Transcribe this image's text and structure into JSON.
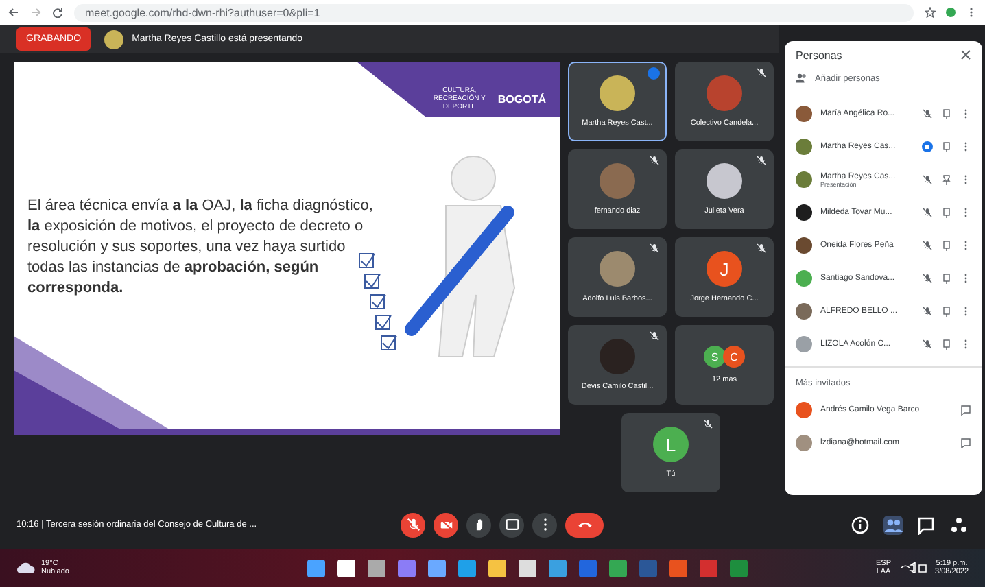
{
  "browser": {
    "url": "meet.google.com/rhd-dwn-rhi?authuser=0&pli=1"
  },
  "meet_header": {
    "recording_label": "GRABANDO",
    "presenter_text": "Martha Reyes Castillo está presentando"
  },
  "slide": {
    "body": "El área técnica envía **a la** OAJ, **la** ficha diagnóstico, **la** exposición de motivos, el proyecto de decreto o resolución y sus soportes, una vez haya surtido todas las instancias de **aprobación, según corresponda.**",
    "logo_text": "CULTURA, RECREACIÓN Y DEPORTE",
    "logo_city": "BOGOTÁ"
  },
  "tiles": [
    {
      "name": "Martha Reyes Cast...",
      "kind": "photo",
      "color": "#c9b458",
      "speaking": true
    },
    {
      "name": "Colectivo Candela...",
      "kind": "photo",
      "color": "#b8432e",
      "speaking": false
    },
    {
      "name": "fernando diaz",
      "kind": "photo",
      "color": "#8a6a50",
      "speaking": false
    },
    {
      "name": "Julieta Vera",
      "kind": "photo",
      "color": "#c7c7cf",
      "speaking": false
    },
    {
      "name": "Adolfo Luis Barbos...",
      "kind": "photo",
      "color": "#9c8a6e",
      "speaking": false
    },
    {
      "name": "Jorge Hernando C...",
      "kind": "letter",
      "letter": "J",
      "color": "#e8521e",
      "speaking": false
    },
    {
      "name": "Devis Camilo Castil...",
      "kind": "photo",
      "color": "#2a2220",
      "speaking": false
    },
    {
      "name": "12 más",
      "kind": "more",
      "avatars": [
        {
          "letter": "S",
          "color": "#4caf50"
        },
        {
          "letter": "C",
          "color": "#e8521e"
        }
      ]
    },
    {
      "name": "Tú",
      "kind": "letter",
      "letter": "L",
      "color": "#4caf50",
      "speaking": false
    }
  ],
  "people_panel": {
    "title": "Personas",
    "add_label": "Añadir personas",
    "participants": [
      {
        "name": "María Angélica Ro...",
        "color": "#8a5a3a",
        "speaking": false,
        "presenting": false
      },
      {
        "name": "Martha Reyes Cas...",
        "color": "#6b7d3a",
        "speaking": true,
        "presenting": false
      },
      {
        "name": "Martha Reyes Cas...",
        "subtitle": "Presentación",
        "color": "#6b7d3a",
        "speaking": false,
        "presenting": true
      },
      {
        "name": "Mildeda Tovar Mu...",
        "color": "#1e1e1e",
        "speaking": false,
        "presenting": false
      },
      {
        "name": "Oneida Flores Peña",
        "color": "#6a4a30",
        "speaking": false,
        "presenting": false
      },
      {
        "name": "Santiago Sandova...",
        "color": "#4caf50",
        "speaking": false,
        "presenting": false
      },
      {
        "name": "ALFREDO BELLO ...",
        "color": "#7a6a5a",
        "speaking": false,
        "presenting": false
      },
      {
        "name": "LIZOLA Acolón C...",
        "color": "#9aa0a6",
        "speaking": false,
        "presenting": false
      }
    ],
    "others_heading": "Más invitados",
    "others": [
      {
        "name": "Andrés Camilo Vega Barco",
        "color": "#e8521e"
      },
      {
        "name": "lzdiana@hotmail.com",
        "color": "#a09080"
      }
    ]
  },
  "footer": {
    "time": "10:16",
    "separator": "|",
    "meeting_title": "Tercera sesión ordinaria del Consejo de Cultura de ..."
  },
  "controls": [
    {
      "kind": "mic",
      "off": true
    },
    {
      "kind": "camera",
      "off": true
    },
    {
      "kind": "hand"
    },
    {
      "kind": "present"
    },
    {
      "kind": "more"
    },
    {
      "kind": "hangup"
    }
  ],
  "side_buttons": [
    {
      "kind": "info",
      "selected": false
    },
    {
      "kind": "people",
      "selected": true
    },
    {
      "kind": "chat",
      "selected": false
    },
    {
      "kind": "activities",
      "selected": false
    }
  ],
  "taskbar": {
    "weather_temp": "19°C",
    "weather_text": "Nublado",
    "lang": "ESP",
    "lang_sub": "LAA",
    "time": "5:19 p.m.",
    "date": "3/08/2022"
  }
}
